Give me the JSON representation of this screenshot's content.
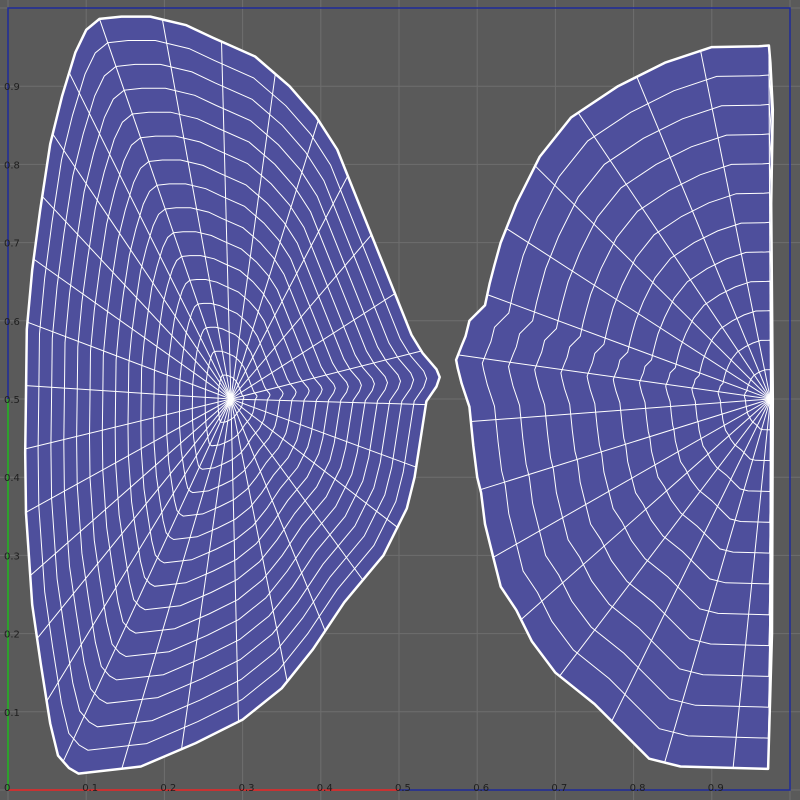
{
  "viewport": {
    "background_color": "#5a5a5a",
    "grid_color": "#6e6e6e",
    "shell_fill": "#4e4f9c",
    "wire_color": "#ffffff",
    "u_axis_color": "#c83232",
    "v_axis_color": "#2ea12e",
    "frame_color": "#1e2a9a",
    "u_range": [
      0,
      1
    ],
    "v_range": [
      0,
      1
    ],
    "grid_step": 0.1
  },
  "axis_labels": {
    "u": [
      "0",
      "0.1",
      "0.2",
      "0.3",
      "0.4",
      "0.5",
      "0.6",
      "0.7",
      "0.8",
      "0.9"
    ],
    "v": [
      "0.1",
      "0.2",
      "0.3",
      "0.4",
      "0.5",
      "0.6",
      "0.7",
      "0.8",
      "0.9"
    ]
  },
  "uv_shells": [
    {
      "name": "left-shell",
      "outline_uv": [
        [
          0.117,
          0.986
        ],
        [
          0.145,
          0.989
        ],
        [
          0.182,
          0.989
        ],
        [
          0.228,
          0.978
        ],
        [
          0.262,
          0.962
        ],
        [
          0.316,
          0.938
        ],
        [
          0.36,
          0.9
        ],
        [
          0.394,
          0.861
        ],
        [
          0.421,
          0.819
        ],
        [
          0.516,
          0.582
        ],
        [
          0.53,
          0.559
        ],
        [
          0.548,
          0.538
        ],
        [
          0.552,
          0.528
        ],
        [
          0.548,
          0.516
        ],
        [
          0.535,
          0.497
        ],
        [
          0.52,
          0.4
        ],
        [
          0.51,
          0.36
        ],
        [
          0.48,
          0.3
        ],
        [
          0.43,
          0.24
        ],
        [
          0.39,
          0.18
        ],
        [
          0.35,
          0.13
        ],
        [
          0.3,
          0.09
        ],
        [
          0.24,
          0.06
        ],
        [
          0.17,
          0.03
        ],
        [
          0.09,
          0.021
        ],
        [
          0.078,
          0.028
        ],
        [
          0.064,
          0.044
        ],
        [
          0.054,
          0.085
        ],
        [
          0.042,
          0.161
        ],
        [
          0.031,
          0.237
        ],
        [
          0.023,
          0.354
        ],
        [
          0.022,
          0.431
        ],
        [
          0.023,
          0.507
        ],
        [
          0.024,
          0.589
        ],
        [
          0.031,
          0.665
        ],
        [
          0.041,
          0.741
        ],
        [
          0.054,
          0.826
        ],
        [
          0.069,
          0.887
        ],
        [
          0.086,
          0.943
        ],
        [
          0.1,
          0.972
        ]
      ],
      "axis_uv": [
        0.285,
        0.5
      ],
      "rings": 16,
      "spokes": 30
    },
    {
      "name": "right-shell",
      "outline_uv": [
        [
          0.973,
          0.952
        ],
        [
          0.96,
          0.951
        ],
        [
          0.9,
          0.95
        ],
        [
          0.84,
          0.93
        ],
        [
          0.78,
          0.9
        ],
        [
          0.72,
          0.86
        ],
        [
          0.68,
          0.81
        ],
        [
          0.65,
          0.75
        ],
        [
          0.63,
          0.7
        ],
        [
          0.622,
          0.671
        ],
        [
          0.616,
          0.648
        ],
        [
          0.61,
          0.62
        ],
        [
          0.59,
          0.6
        ],
        [
          0.585,
          0.58
        ],
        [
          0.58,
          0.568
        ],
        [
          0.573,
          0.55
        ],
        [
          0.575,
          0.54
        ],
        [
          0.58,
          0.52
        ],
        [
          0.59,
          0.49
        ],
        [
          0.595,
          0.44
        ],
        [
          0.6,
          0.4
        ],
        [
          0.605,
          0.38
        ],
        [
          0.61,
          0.34
        ],
        [
          0.62,
          0.3
        ],
        [
          0.63,
          0.26
        ],
        [
          0.65,
          0.23
        ],
        [
          0.67,
          0.19
        ],
        [
          0.7,
          0.15
        ],
        [
          0.75,
          0.11
        ],
        [
          0.79,
          0.07
        ],
        [
          0.82,
          0.04
        ],
        [
          0.86,
          0.03
        ],
        [
          0.972,
          0.027
        ],
        [
          0.977,
          0.2
        ],
        [
          0.978,
          0.5
        ],
        [
          0.976,
          0.75
        ],
        [
          0.978,
          0.87
        ],
        [
          0.975,
          0.93
        ]
      ],
      "axis_uv": [
        0.975,
        0.5
      ],
      "rings": 12,
      "spokes": 26
    }
  ]
}
